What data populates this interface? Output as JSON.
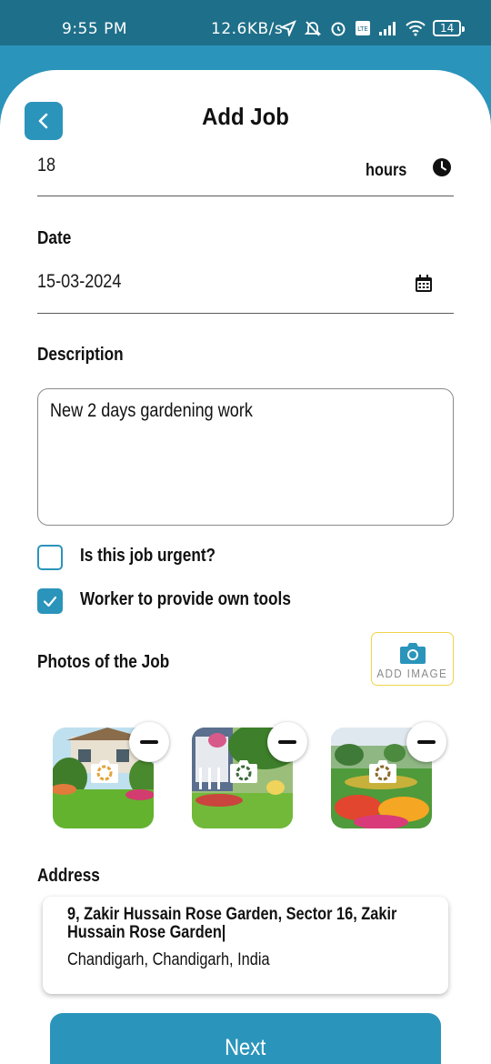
{
  "status_bar": {
    "time": "9:55 PM",
    "net_speed": "12.6KB/s",
    "battery": "14"
  },
  "header": {
    "title": "Add Job",
    "back_icon": "chevron-left-icon"
  },
  "duration": {
    "value": "18",
    "unit": "hours",
    "icon": "clock-icon"
  },
  "date": {
    "label": "Date",
    "value": "15-03-2024",
    "icon": "calendar-icon"
  },
  "description": {
    "label": "Description",
    "value": "New 2 days gardening work"
  },
  "options": [
    {
      "label": "Is this job urgent?",
      "checked": false
    },
    {
      "label": "Worker to provide own tools",
      "checked": true
    }
  ],
  "photos": {
    "label": "Photos of the Job",
    "add_button_label": "ADD IMAGE",
    "items": [
      {
        "subject": "house-garden-photo"
      },
      {
        "subject": "porch-garden-photo"
      },
      {
        "subject": "flower-park-photo"
      }
    ]
  },
  "address": {
    "label": "Address",
    "line1": "9, Zakir Hussain Rose Garden, Sector 16, Zakir Hussain Rose Garden|",
    "line2": "Chandigarh, Chandigarh, India"
  },
  "footer": {
    "next_label": "Next"
  },
  "colors": {
    "accent": "#2b94bb",
    "status_bar": "#1e6f89",
    "add_image_border": "#f0d34a"
  }
}
